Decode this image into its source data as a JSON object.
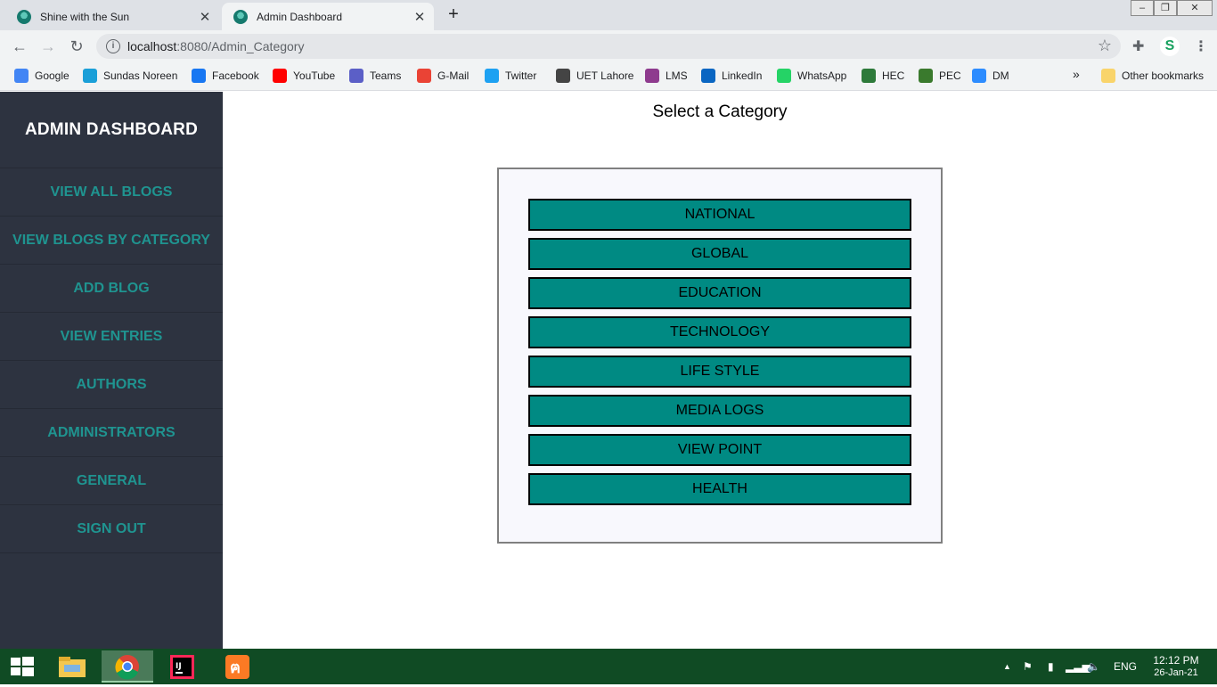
{
  "browser": {
    "tabs": [
      {
        "title": "Shine with the Sun",
        "active": false
      },
      {
        "title": "Admin Dashboard",
        "active": true
      }
    ],
    "url_host": "localhost",
    "url_rest": ":8080/Admin_Category",
    "bookmarks": [
      {
        "label": "Google",
        "icon": "google-icon",
        "color": "#4285f4"
      },
      {
        "label": "Sundas Noreen",
        "icon": "s-icon",
        "color": "#1a9fd8"
      },
      {
        "label": "Facebook",
        "icon": "facebook-icon",
        "color": "#1877f2"
      },
      {
        "label": "YouTube",
        "icon": "youtube-icon",
        "color": "#ff0000"
      },
      {
        "label": "Teams",
        "icon": "teams-icon",
        "color": "#5b5fc7"
      },
      {
        "label": "G-Mail",
        "icon": "gmail-icon",
        "color": "#ea4335"
      },
      {
        "label": "Twitter",
        "icon": "twitter-icon",
        "color": "#1da1f2"
      },
      {
        "label": "UET Lahore",
        "icon": "uet-icon",
        "color": "#444444"
      },
      {
        "label": "LMS",
        "icon": "lms-icon",
        "color": "#8e3b8e"
      },
      {
        "label": "LinkedIn",
        "icon": "linkedin-icon",
        "color": "#0a66c2"
      },
      {
        "label": "WhatsApp",
        "icon": "whatsapp-icon",
        "color": "#25d366"
      },
      {
        "label": "HEC",
        "icon": "hec-icon",
        "color": "#2d7a3a"
      },
      {
        "label": "PEC",
        "icon": "pec-icon",
        "color": "#3a7a2d"
      },
      {
        "label": "DM",
        "icon": "zoom-icon",
        "color": "#2d8cff"
      }
    ],
    "overflow": "»",
    "other_bookmarks": "Other bookmarks"
  },
  "sidebar": {
    "title": "ADMIN DASHBOARD",
    "items": [
      {
        "label": "VIEW ALL BLOGS"
      },
      {
        "label": "VIEW BLOGS BY CATEGORY"
      },
      {
        "label": "ADD BLOG"
      },
      {
        "label": "VIEW ENTRIES"
      },
      {
        "label": "AUTHORS"
      },
      {
        "label": "ADMINISTRATORS"
      },
      {
        "label": "GENERAL"
      },
      {
        "label": "SIGN OUT"
      }
    ]
  },
  "main": {
    "heading": "Select a Category",
    "categories": [
      {
        "label": "NATIONAL"
      },
      {
        "label": "GLOBAL"
      },
      {
        "label": "EDUCATION"
      },
      {
        "label": "TECHNOLOGY"
      },
      {
        "label": "LIFE STYLE"
      },
      {
        "label": "MEDIA LOGS"
      },
      {
        "label": "VIEW POINT"
      },
      {
        "label": "HEALTH"
      }
    ]
  },
  "taskbar": {
    "language": "ENG",
    "time": "12:12 PM",
    "date": "26-Jan-21"
  },
  "colors": {
    "sidebar_bg": "#2d3340",
    "sidebar_link": "#1f9490",
    "category_button": "#008a83",
    "taskbar_bg": "#104b24"
  }
}
